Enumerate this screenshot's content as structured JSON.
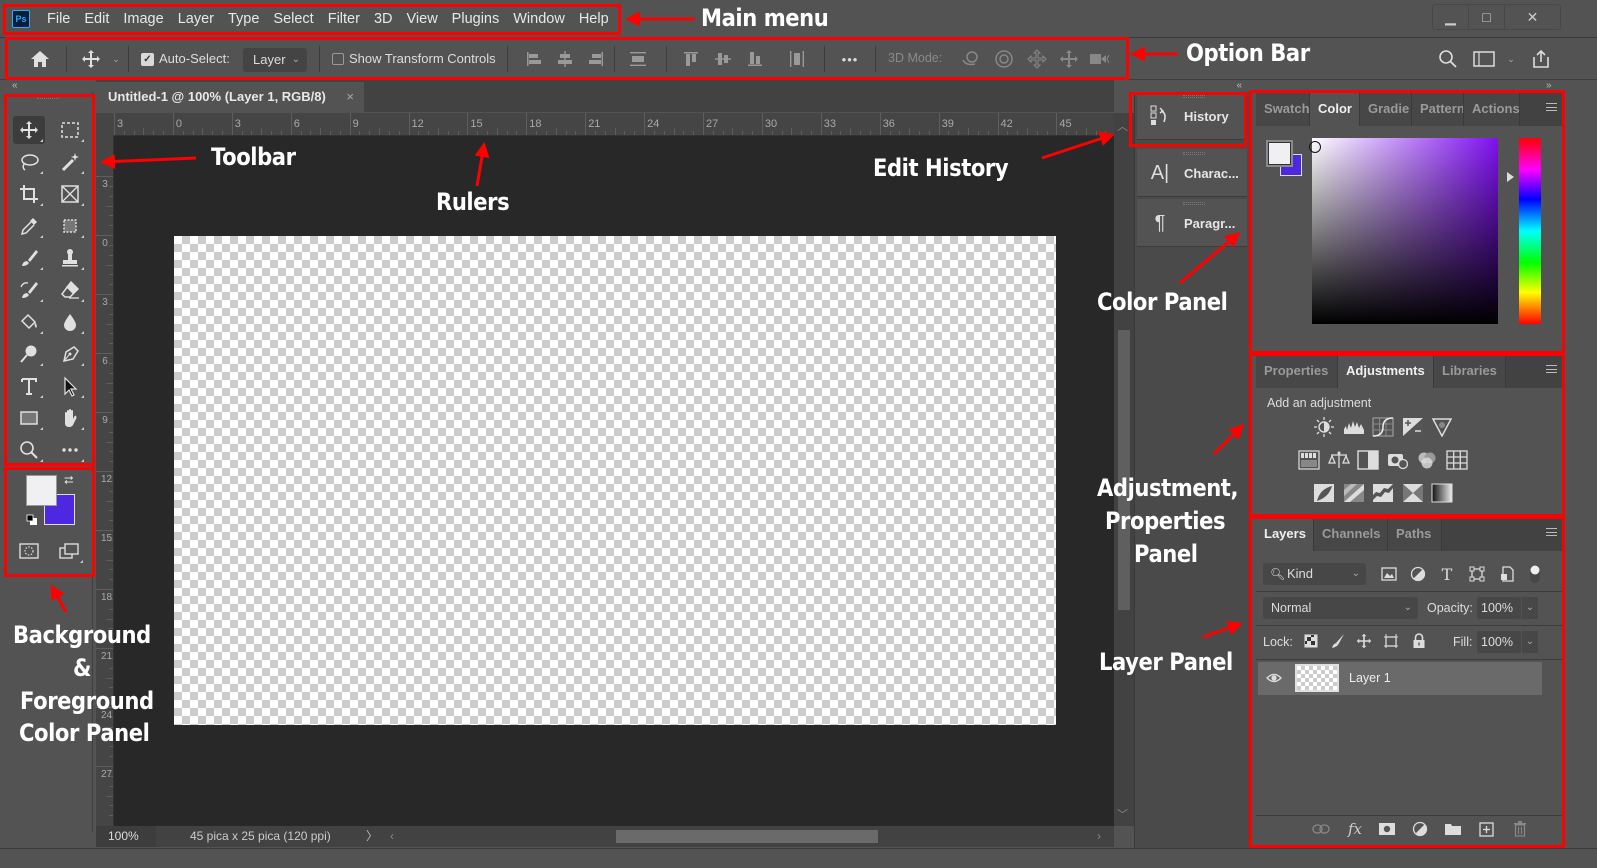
{
  "app": {
    "logo": "Ps",
    "menu": [
      "File",
      "Edit",
      "Image",
      "Layer",
      "Type",
      "Select",
      "Filter",
      "3D",
      "View",
      "Plugins",
      "Window",
      "Help"
    ],
    "window_controls": {
      "minimize": "▁",
      "maximize": "□",
      "close": "✕"
    }
  },
  "options_bar": {
    "home_icon": "home-icon",
    "move_icon": "move-icon",
    "auto_select_checked": true,
    "auto_select_label": "Auto-Select:",
    "auto_select_target": "Layer",
    "show_transform_checked": false,
    "show_transform_label": "Show Transform Controls",
    "align_icons": [
      "align-left-edges-icon",
      "align-horizontal-centers-icon",
      "align-right-edges-icon",
      "distribute-vertical-icon",
      "align-top-edges-icon",
      "align-vertical-centers-icon",
      "align-bottom-edges-icon",
      "distribute-horizontal-icon"
    ],
    "more_label": "•••",
    "mode_3d_label": "3D Mode:",
    "mode_3d_icons": [
      "orbit-3d-icon",
      "roll-3d-icon",
      "pan-3d-icon",
      "slide-3d-icon",
      "zoom-camera-3d-icon"
    ],
    "right_icons": [
      "search-icon",
      "workspace-icon",
      "share-icon"
    ]
  },
  "toolbar": {
    "tools": [
      [
        "move-tool",
        "marquee-tool"
      ],
      [
        "lasso-tool",
        "magic-wand-tool"
      ],
      [
        "crop-tool",
        "frame-tool"
      ],
      [
        "eyedropper-tool",
        "patch-tool"
      ],
      [
        "brush-tool",
        "clone-stamp-tool"
      ],
      [
        "history-brush-tool",
        "eraser-tool"
      ],
      [
        "paint-bucket-tool",
        "blur-tool"
      ],
      [
        "dodge-tool",
        "pen-tool"
      ],
      [
        "type-tool",
        "path-selection-tool"
      ],
      [
        "rectangle-tool",
        "hand-tool"
      ],
      [
        "zoom-tool",
        "more-tools"
      ]
    ],
    "foreground_color": "#f0eff1",
    "background_color": "#4e28e0"
  },
  "document": {
    "tab_title": "Untitled-1 @ 100% (Layer 1, RGB/8)",
    "close": "×",
    "ruler_top_labels": [
      "3",
      "0",
      "3",
      "6",
      "9",
      "12",
      "15",
      "18",
      "21",
      "24",
      "27",
      "30",
      "33",
      "36",
      "39",
      "42",
      "45"
    ],
    "ruler_left_labels": [
      "3",
      "0",
      "3",
      "6",
      "9",
      "12",
      "15",
      "18",
      "21",
      "24",
      "27"
    ],
    "zoom": "100%",
    "info": "45 pica x 25 pica (120 ppi)"
  },
  "dock": {
    "items": [
      {
        "icon": "history-icon",
        "label": "History"
      },
      {
        "icon": "character-icon",
        "label": "Charac..."
      },
      {
        "icon": "paragraph-icon",
        "label": "Paragr..."
      }
    ]
  },
  "color_panel": {
    "tabs": [
      "Swatch",
      "Color",
      "Gradie",
      "Pattern",
      "Actions"
    ],
    "active_tab": "Color",
    "foreground": "#f0eff1",
    "background": "#4e28e0",
    "hue_color": "#7e10f0"
  },
  "adjustments_panel": {
    "tabs": [
      "Properties",
      "Adjustments",
      "Libraries"
    ],
    "active_tab": "Adjustments",
    "heading": "Add an adjustment",
    "rows": [
      [
        "brightness-contrast-icon",
        "levels-icon",
        "curves-icon",
        "exposure-icon",
        "vibrance-icon"
      ],
      [
        "hue-saturation-icon",
        "color-balance-icon",
        "black-white-icon",
        "photo-filter-icon",
        "channel-mixer-icon",
        "color-lookup-icon"
      ],
      [
        "invert-icon",
        "posterize-icon",
        "threshold-icon",
        "selective-color-icon",
        "gradient-map-icon"
      ]
    ]
  },
  "layers_panel": {
    "tabs": [
      "Layers",
      "Channels",
      "Paths"
    ],
    "active_tab": "Layers",
    "filter_kind": "Kind",
    "blend_mode": "Normal",
    "opacity_label": "Opacity:",
    "opacity": "100%",
    "lock_label": "Lock:",
    "fill_label": "Fill:",
    "fill": "100%",
    "layers": [
      {
        "name": "Layer 1",
        "visible": true
      }
    ],
    "footer_icons": [
      "link-layers-icon",
      "fx-icon",
      "layer-mask-icon",
      "adjustment-layer-icon",
      "group-folder-icon",
      "new-layer-icon",
      "trash-icon"
    ]
  },
  "annotations": {
    "main_menu": "Main menu",
    "option_bar": "Option Bar",
    "toolbar": "Toolbar",
    "rulers": "Rulers",
    "edit_history": "Edit History",
    "color_panel": "Color Panel",
    "adjustment_line1": "Adjustment,",
    "adjustment_line2": "Properties",
    "adjustment_line3": "Panel",
    "layer_panel": "Layer Panel",
    "bgfg_line1": "Background",
    "bgfg_line2": "&",
    "bgfg_line3": "Foreground",
    "bgfg_line4": "Color Panel"
  }
}
